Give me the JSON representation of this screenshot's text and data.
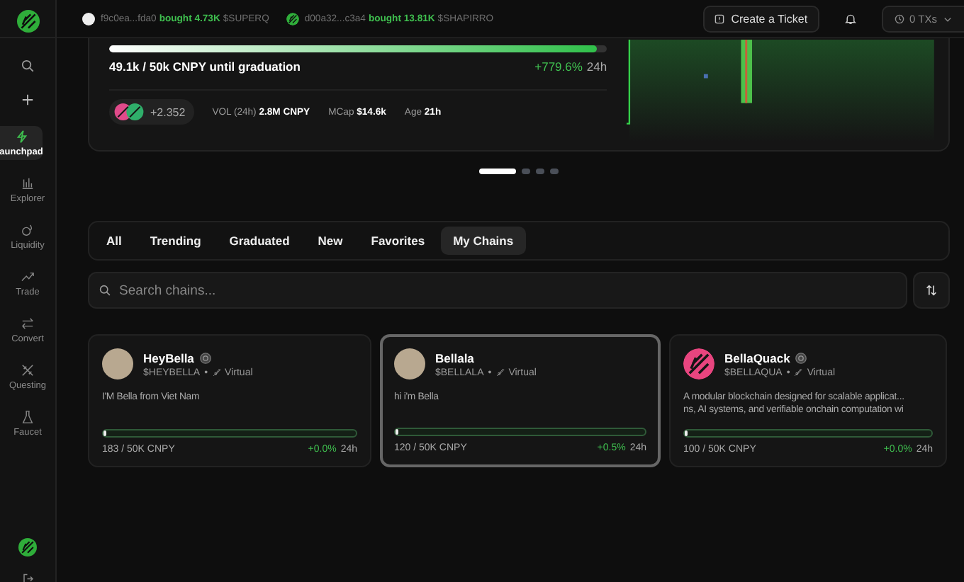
{
  "sidebar": {
    "items": [
      {
        "label": "aunchpad",
        "selected": true
      },
      {
        "label": "Explorer",
        "selected": false
      },
      {
        "label": "Liquidity",
        "selected": false
      },
      {
        "label": "Trade",
        "selected": false
      },
      {
        "label": "Convert",
        "selected": false
      },
      {
        "label": "Questing",
        "selected": false
      },
      {
        "label": "Faucet",
        "selected": false
      }
    ]
  },
  "ticker": [
    {
      "kind": "plain",
      "address": "f9c0ea...fda0",
      "action": "bought 4.73K",
      "symbol": "$SUPERQ"
    },
    {
      "kind": "logo",
      "address": "d00a32...c3a4",
      "action": "bought 13.81K",
      "symbol": "$SHAPIRRO"
    }
  ],
  "header": {
    "ticket_button": "Create a Ticket",
    "txs": "0 TXs"
  },
  "hero": {
    "level": 0.98,
    "progress_text": "49.1k / 50k CNPY until graduation",
    "change": "+779.6%",
    "period": "24h",
    "holders": "+2.352",
    "stats": [
      {
        "label": "VOL (24h)",
        "value": "2.8M CNPY"
      },
      {
        "label": "MCap",
        "value": "$14.6k"
      },
      {
        "label": "Age",
        "value": "21h"
      }
    ]
  },
  "carousel": [
    {
      "selected": true
    },
    {
      "selected": false
    },
    {
      "selected": false
    },
    {
      "selected": false
    }
  ],
  "tabs": [
    {
      "label": "All",
      "selected": false
    },
    {
      "label": "Trending",
      "selected": false
    },
    {
      "label": "Graduated",
      "selected": false
    },
    {
      "label": "New",
      "selected": false
    },
    {
      "label": "Favorites",
      "selected": false
    },
    {
      "label": "My Chains",
      "selected": true
    }
  ],
  "search": {
    "placeholder": "Search chains..."
  },
  "cards": [
    {
      "name": "HeyBella",
      "verified": true,
      "kind": "photo",
      "ticker": "$HEYBELLA",
      "separator": "•",
      "tag": "Virtual",
      "description": [
        "I'M Bella from Viet Nam"
      ],
      "level": 0.01,
      "supply": "183 / 50K CNPY",
      "change": "+0.0%",
      "period": "24h",
      "selected": false
    },
    {
      "name": "Bellala",
      "verified": false,
      "kind": "photo",
      "ticker": "$BELLALA",
      "separator": "•",
      "tag": "Virtual",
      "description": [
        "hi i'm Bella"
      ],
      "level": 0.01,
      "supply": "120 / 50K CNPY",
      "change": "+0.5%",
      "period": "24h",
      "selected": true
    },
    {
      "name": "BellaQuack",
      "verified": true,
      "kind": "logo",
      "ticker": "$BELLAQUA",
      "separator": "•",
      "tag": "Virtual",
      "description": [
        "A modular blockchain designed for scalable applicat...",
        "ns, AI systems, and verifiable onchain computation wi"
      ],
      "level": 0.01,
      "supply": "100 / 50K CNPY",
      "change": "+0.0%",
      "period": "24h",
      "selected": false
    }
  ]
}
